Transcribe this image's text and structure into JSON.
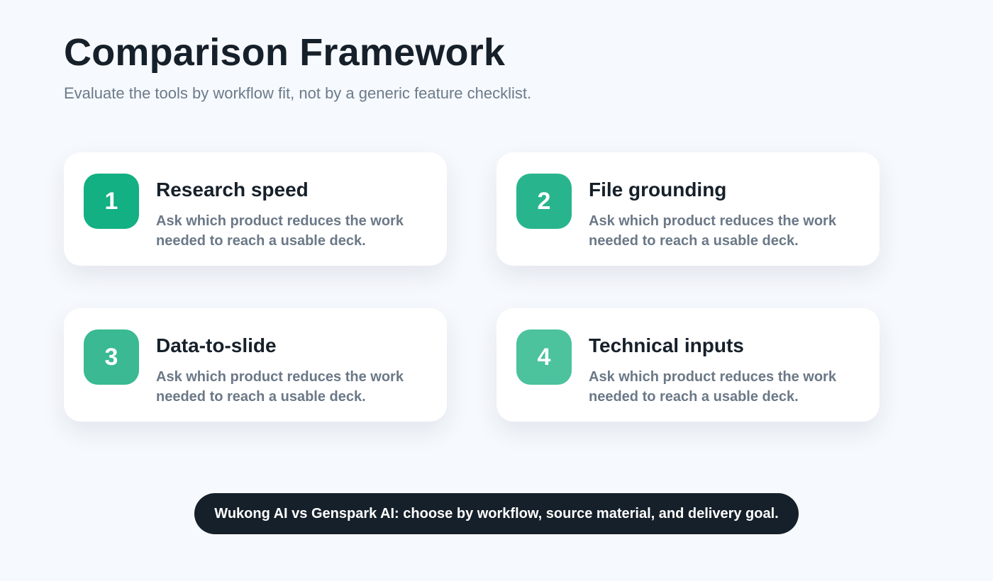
{
  "header": {
    "title": "Comparison Framework",
    "subtitle": "Evaluate the tools by workflow fit, not by a generic feature checklist."
  },
  "cards": [
    {
      "number": "1",
      "title": "Research speed",
      "description": "Ask which product reduces the work needed to reach a usable deck.",
      "badge_color": "#12b082"
    },
    {
      "number": "2",
      "title": "File grounding",
      "description": "Ask which product reduces the work needed to reach a usable deck.",
      "badge_color": "#28b58d"
    },
    {
      "number": "3",
      "title": "Data-to-slide",
      "description": "Ask which product reduces the work needed to reach a usable deck.",
      "badge_color": "#3ab993"
    },
    {
      "number": "4",
      "title": "Technical inputs",
      "description": "Ask which product reduces the work needed to reach a usable deck.",
      "badge_color": "#4cc29d"
    }
  ],
  "footer": {
    "text": "Wukong AI vs Genspark AI: choose by workflow, source material, and delivery goal."
  },
  "colors": {
    "background": "#f6f9fd",
    "text_dark": "#16202a",
    "text_muted": "#6b7887",
    "footer_background": "#16202a"
  }
}
